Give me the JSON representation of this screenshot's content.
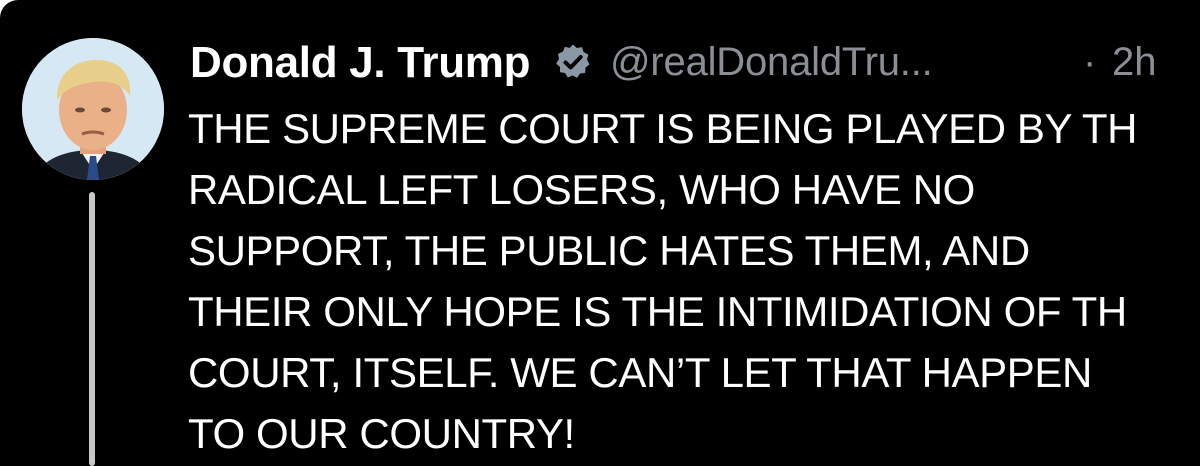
{
  "post": {
    "author": {
      "display_name": "Donald J. Trump",
      "handle": "@realDonaldTru...",
      "verified": true,
      "avatar_icon": "profile-photo"
    },
    "separator": "·",
    "time": "2h",
    "header_icon": "grok-icon",
    "text_lines": [
      "THE SUPREME COURT IS BEING PLAYED BY TH",
      "RADICAL LEFT LOSERS, WHO HAVE NO",
      "SUPPORT, THE PUBLIC HATES THEM, AND",
      "THEIR ONLY HOPE IS THE INTIMIDATION OF TH",
      "COURT, ITSELF. WE CAN’T LET THAT HAPPEN",
      "TO OUR COUNTRY!"
    ]
  },
  "colors": {
    "background": "#000000",
    "text": "#ffffff",
    "secondary_text": "#8b8f95",
    "verified_badge": "#8b98a5",
    "thread_line": "#c8c8c8"
  }
}
